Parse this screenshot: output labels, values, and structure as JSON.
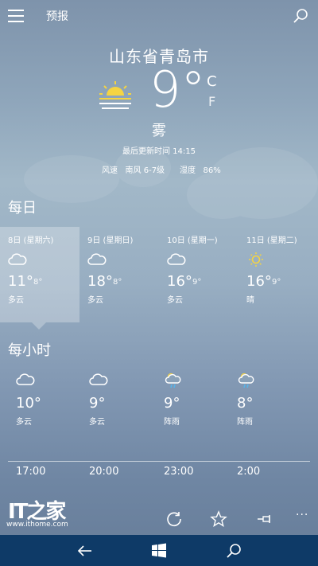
{
  "header": {
    "title": "预报"
  },
  "current": {
    "city": "山东省青岛市",
    "temperature": "9°",
    "unit_c": "C",
    "unit_f": "F",
    "condition": "雾",
    "updated": "最后更新时间 14:15",
    "wind_label": "风速",
    "wind_value": "南风 6-7级",
    "humidity_label": "湿度",
    "humidity_value": "86%",
    "icon": "fog-sun-icon"
  },
  "daily": {
    "title": "每日",
    "days": [
      {
        "date": "8日 (星期六)",
        "hi": "11°",
        "lo": "8°",
        "cond": "多云",
        "icon": "cloud-icon"
      },
      {
        "date": "9日 (星期日)",
        "hi": "18°",
        "lo": "8°",
        "cond": "多云",
        "icon": "cloud-icon"
      },
      {
        "date": "10日 (星期一)",
        "hi": "16°",
        "lo": "9°",
        "cond": "多云",
        "icon": "cloud-icon"
      },
      {
        "date": "11日 (星期二)",
        "hi": "16°",
        "lo": "9°",
        "cond": "晴",
        "icon": "sun-icon"
      }
    ]
  },
  "hourly": {
    "title": "每小时",
    "hours": [
      {
        "temp": "10°",
        "cond": "多云",
        "time": "17:00",
        "icon": "cloud-icon"
      },
      {
        "temp": "9°",
        "cond": "多云",
        "time": "20:00",
        "icon": "cloud-icon"
      },
      {
        "temp": "9°",
        "cond": "阵雨",
        "time": "23:00",
        "icon": "shower-icon"
      },
      {
        "temp": "8°",
        "cond": "阵雨",
        "time": "2:00",
        "icon": "shower-icon"
      }
    ]
  },
  "appbar": {
    "more": "···"
  },
  "watermark": {
    "logo": "IT之家",
    "url": "www.ithome.com"
  },
  "colors": {
    "nav_bar": "#0e3a67",
    "sun": "#f5d442",
    "rain": "#58b4e8"
  }
}
